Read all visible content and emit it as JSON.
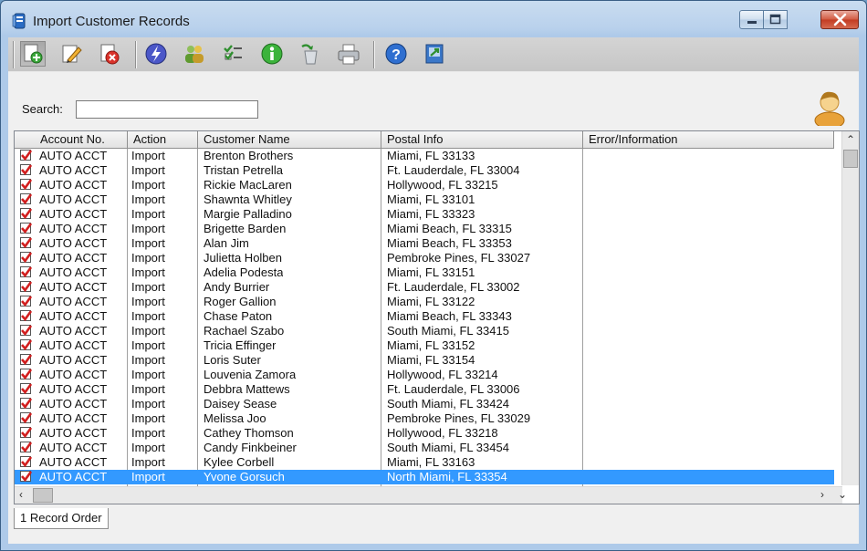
{
  "window": {
    "title": "Import Customer Records"
  },
  "toolbar": {
    "buttons": [
      {
        "icon": "add-record-icon",
        "pressed": true
      },
      {
        "icon": "edit-icon"
      },
      {
        "icon": "delete-icon"
      },
      {
        "icon": "lightning-icon"
      },
      {
        "icon": "users-group-icon"
      },
      {
        "icon": "checklist-icon"
      },
      {
        "icon": "info-icon"
      },
      {
        "icon": "recycle-icon"
      },
      {
        "icon": "printer-icon"
      },
      {
        "icon": "help-icon"
      },
      {
        "icon": "export-icon"
      }
    ]
  },
  "search": {
    "label": "Search:",
    "value": ""
  },
  "grid": {
    "columns": [
      "Account No.",
      "Action",
      "Customer Name",
      "Postal Info",
      "Error/Information"
    ],
    "rows": [
      {
        "checked": true,
        "account": "AUTO ACCT",
        "action": "Import",
        "name": "Brenton Brothers",
        "postal": "Miami, FL 33133",
        "error": ""
      },
      {
        "checked": true,
        "account": "AUTO ACCT",
        "action": "Import",
        "name": "Tristan Petrella",
        "postal": "Ft. Lauderdale, FL 33004",
        "error": ""
      },
      {
        "checked": true,
        "account": "AUTO ACCT",
        "action": "Import",
        "name": "Rickie MacLaren",
        "postal": "Hollywood, FL 33215",
        "error": ""
      },
      {
        "checked": true,
        "account": "AUTO ACCT",
        "action": "Import",
        "name": "Shawnta Whitley",
        "postal": "Miami, FL 33101",
        "error": ""
      },
      {
        "checked": true,
        "account": "AUTO ACCT",
        "action": "Import",
        "name": "Margie Palladino",
        "postal": "Miami, FL 33323",
        "error": ""
      },
      {
        "checked": true,
        "account": "AUTO ACCT",
        "action": "Import",
        "name": "Brigette Barden",
        "postal": "Miami Beach, FL 33315",
        "error": ""
      },
      {
        "checked": true,
        "account": "AUTO ACCT",
        "action": "Import",
        "name": "Alan Jim",
        "postal": "Miami Beach, FL 33353",
        "error": ""
      },
      {
        "checked": true,
        "account": "AUTO ACCT",
        "action": "Import",
        "name": "Julietta Holben",
        "postal": "Pembroke Pines, FL 33027",
        "error": ""
      },
      {
        "checked": true,
        "account": "AUTO ACCT",
        "action": "Import",
        "name": "Adelia Podesta",
        "postal": "Miami, FL 33151",
        "error": ""
      },
      {
        "checked": true,
        "account": "AUTO ACCT",
        "action": "Import",
        "name": "Andy Burrier",
        "postal": "Ft. Lauderdale, FL 33002",
        "error": ""
      },
      {
        "checked": true,
        "account": "AUTO ACCT",
        "action": "Import",
        "name": "Roger Gallion",
        "postal": "Miami, FL 33122",
        "error": ""
      },
      {
        "checked": true,
        "account": "AUTO ACCT",
        "action": "Import",
        "name": "Chase Paton",
        "postal": "Miami Beach, FL 33343",
        "error": ""
      },
      {
        "checked": true,
        "account": "AUTO ACCT",
        "action": "Import",
        "name": "Rachael Szabo",
        "postal": "South Miami, FL 33415",
        "error": ""
      },
      {
        "checked": true,
        "account": "AUTO ACCT",
        "action": "Import",
        "name": "Tricia Effinger",
        "postal": "Miami, FL 33152",
        "error": ""
      },
      {
        "checked": true,
        "account": "AUTO ACCT",
        "action": "Import",
        "name": "Loris Suter",
        "postal": "Miami, FL 33154",
        "error": ""
      },
      {
        "checked": true,
        "account": "AUTO ACCT",
        "action": "Import",
        "name": "Louvenia Zamora",
        "postal": "Hollywood, FL 33214",
        "error": ""
      },
      {
        "checked": true,
        "account": "AUTO ACCT",
        "action": "Import",
        "name": "Debbra Mattews",
        "postal": "Ft. Lauderdale, FL 33006",
        "error": ""
      },
      {
        "checked": true,
        "account": "AUTO ACCT",
        "action": "Import",
        "name": "Daisey Sease",
        "postal": "South Miami, FL 33424",
        "error": ""
      },
      {
        "checked": true,
        "account": "AUTO ACCT",
        "action": "Import",
        "name": "Melissa Joo",
        "postal": "Pembroke Pines, FL 33029",
        "error": ""
      },
      {
        "checked": true,
        "account": "AUTO ACCT",
        "action": "Import",
        "name": "Cathey Thomson",
        "postal": "Hollywood, FL 33218",
        "error": ""
      },
      {
        "checked": true,
        "account": "AUTO ACCT",
        "action": "Import",
        "name": "Candy Finkbeiner",
        "postal": "South Miami, FL 33454",
        "error": ""
      },
      {
        "checked": true,
        "account": "AUTO ACCT",
        "action": "Import",
        "name": "Kylee Corbell",
        "postal": "Miami, FL 33163",
        "error": ""
      },
      {
        "checked": true,
        "account": "AUTO ACCT",
        "action": "Import",
        "name": "Yvone Gorsuch",
        "postal": "North Miami, FL 33354",
        "error": "",
        "selected": true
      }
    ]
  },
  "tabs": [
    {
      "label": "1 Record Order"
    }
  ],
  "colors": {
    "selection": "#3399ff",
    "check": "#d21f1f"
  }
}
